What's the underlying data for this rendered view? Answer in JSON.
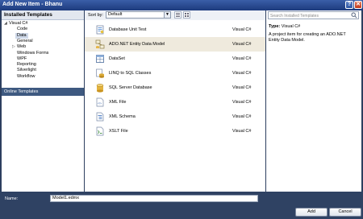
{
  "window": {
    "title": "Add New Item - Bhanu"
  },
  "left_panel": {
    "header": "Installed Templates",
    "tree": [
      {
        "label": "Visual C#",
        "expander": "◢",
        "indent": 0,
        "selected": false
      },
      {
        "label": "Code",
        "indent": 1,
        "selected": false
      },
      {
        "label": "Data",
        "indent": 1,
        "selected": true
      },
      {
        "label": "General",
        "indent": 1,
        "selected": false
      },
      {
        "label": "Web",
        "expander": "▷",
        "indent": 1,
        "selected": false
      },
      {
        "label": "Windows Forms",
        "indent": 1,
        "selected": false
      },
      {
        "label": "WPF",
        "indent": 1,
        "selected": false
      },
      {
        "label": "Reporting",
        "indent": 1,
        "selected": false
      },
      {
        "label": "Silverlight",
        "indent": 1,
        "selected": false
      },
      {
        "label": "Workflow",
        "indent": 1,
        "selected": false
      }
    ],
    "online": "Online Templates"
  },
  "toolbar": {
    "sort_label": "Sort by:",
    "sort_value": "Default",
    "sort_arrow": "▼"
  },
  "items": [
    {
      "name": "Database Unit Test",
      "lang": "Visual C#",
      "icon": "unit-test-icon",
      "selected": false
    },
    {
      "name": "ADO.NET Entity Data Model",
      "lang": "Visual C#",
      "icon": "entity-model-icon",
      "selected": true
    },
    {
      "name": "DataSet",
      "lang": "Visual C#",
      "icon": "dataset-icon",
      "selected": false
    },
    {
      "name": "LINQ to SQL Classes",
      "lang": "Visual C#",
      "icon": "linq-icon",
      "selected": false
    },
    {
      "name": "SQL Server Database",
      "lang": "Visual C#",
      "icon": "database-icon",
      "selected": false
    },
    {
      "name": "XML File",
      "lang": "Visual C#",
      "icon": "xml-file-icon",
      "selected": false
    },
    {
      "name": "XML Schema",
      "lang": "Visual C#",
      "icon": "xml-schema-icon",
      "selected": false
    },
    {
      "name": "XSLT File",
      "lang": "Visual C#",
      "icon": "xslt-file-icon",
      "selected": false
    }
  ],
  "right_panel": {
    "search_placeholder": "Search Installed Templates",
    "type_label": "Type:",
    "type_value": "Visual C#",
    "description": "A project item for creating an ADO.NET Entity Data Model."
  },
  "bottom": {
    "name_label": "Name:",
    "name_value": "Model1.edmx",
    "add_label": "Add",
    "cancel_label": "Cancel"
  }
}
